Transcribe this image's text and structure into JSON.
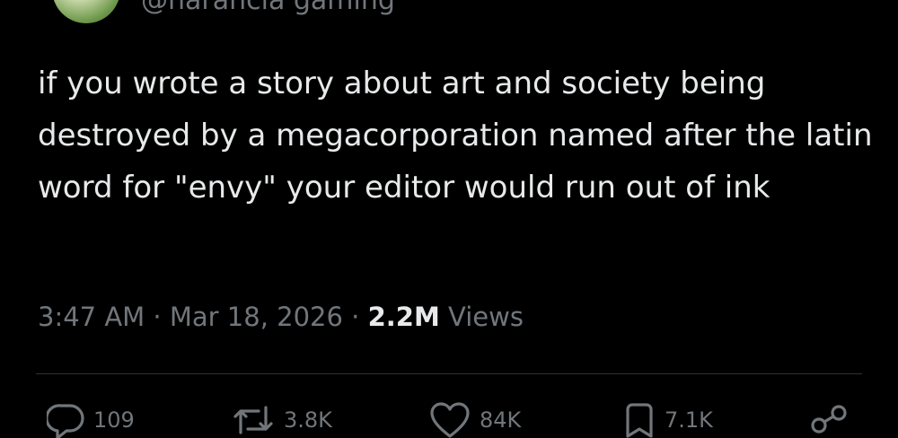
{
  "author": {
    "handle": "@narancia gaming",
    "avatar_icon": "avatar-icon"
  },
  "tweet": {
    "text": "if you wrote a story about art and society being destroyed by a megacorporation named after the latin word for \"envy\" your editor would run out of ink"
  },
  "meta": {
    "time": "3:47 AM",
    "separator1": " · ",
    "date": "Mar 18, 2026",
    "separator2": " · ",
    "views_count": "2.2M",
    "views_label": " Views"
  },
  "actions": {
    "replies": "109",
    "reposts": "3.8K",
    "likes": "84K",
    "bookmarks": "7.1K"
  },
  "colors": {
    "background": "#000000",
    "text": "#e7e9ea",
    "secondary": "#71767b",
    "divider": "#2f3336"
  }
}
